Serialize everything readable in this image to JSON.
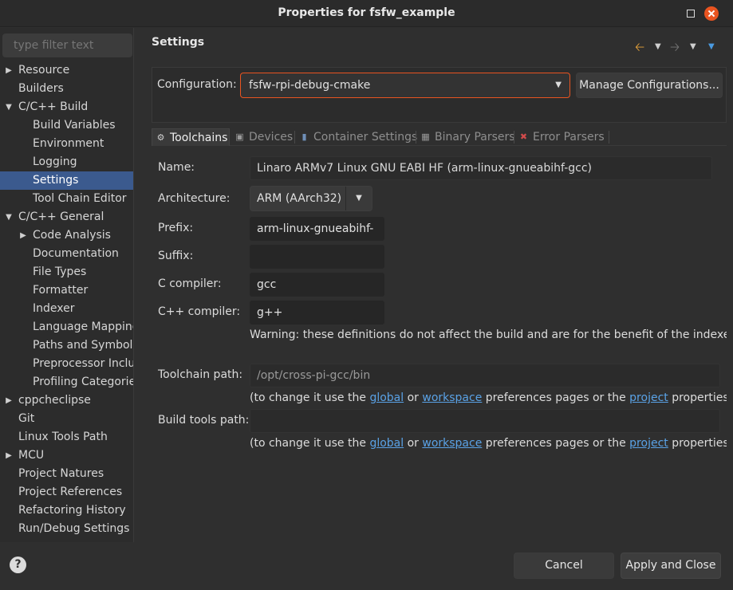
{
  "window": {
    "title": "Properties for fsfw_example"
  },
  "sidebar": {
    "filter_placeholder": "type filter text",
    "items": [
      {
        "label": "Resource",
        "arrow": "▶"
      },
      {
        "label": "Builders"
      },
      {
        "label": "C/C++ Build",
        "arrow": "▼"
      },
      {
        "label": "Build Variables"
      },
      {
        "label": "Environment"
      },
      {
        "label": "Logging"
      },
      {
        "label": "Settings"
      },
      {
        "label": "Tool Chain Editor"
      },
      {
        "label": "C/C++ General",
        "arrow": "▼"
      },
      {
        "label": "Code Analysis",
        "arrow": "▶"
      },
      {
        "label": "Documentation"
      },
      {
        "label": "File Types"
      },
      {
        "label": "Formatter"
      },
      {
        "label": "Indexer"
      },
      {
        "label": "Language Mapping"
      },
      {
        "label": "Paths and Symbols"
      },
      {
        "label": "Preprocessor Inclu"
      },
      {
        "label": "Profiling Categorie"
      },
      {
        "label": "cppcheclipse",
        "arrow": "▶"
      },
      {
        "label": "Git"
      },
      {
        "label": "Linux Tools Path"
      },
      {
        "label": "MCU",
        "arrow": "▶"
      },
      {
        "label": "Project Natures"
      },
      {
        "label": "Project References"
      },
      {
        "label": "Refactoring History"
      },
      {
        "label": "Run/Debug Settings"
      }
    ]
  },
  "header": {
    "title": "Settings"
  },
  "configuration": {
    "label": "Configuration:",
    "value": "fsfw-rpi-debug-cmake",
    "manage_label": "Manage Configurations..."
  },
  "tabs": [
    {
      "label": "Toolchains",
      "icon": "toolchain-icon"
    },
    {
      "label": "Devices",
      "icon": "devices-icon"
    },
    {
      "label": "Container Settings",
      "icon": "container-icon"
    },
    {
      "label": "Binary Parsers",
      "icon": "binary-icon"
    },
    {
      "label": "Error Parsers",
      "icon": "error-icon"
    }
  ],
  "toolchain": {
    "name_label": "Name:",
    "name_value": "Linaro ARMv7 Linux GNU EABI HF (arm-linux-gnueabihf-gcc)",
    "arch_label": "Architecture:",
    "arch_value": "ARM (AArch32)",
    "prefix_label": "Prefix:",
    "prefix_value": "arm-linux-gnueabihf-",
    "suffix_label": "Suffix:",
    "suffix_value": "",
    "c_label": "C compiler:",
    "c_value": "gcc",
    "cpp_label": "C++ compiler:",
    "cpp_value": "g++",
    "warning": "Warning: these definitions do not affect the build and are for the benefit of the indexer o",
    "path_label": "Toolchain path:",
    "path_value": "/opt/cross-pi-gcc/bin",
    "build_tools_label": "Build tools path:",
    "build_tools_value": "",
    "note_prefix": "(to change it use the ",
    "note_global": "global",
    "note_or": " or ",
    "note_workspace": "workspace",
    "note_mid": " preferences pages or the ",
    "note_project": "project",
    "note_suffix": " properties p"
  },
  "footer": {
    "help": "?",
    "cancel_label": "Cancel",
    "apply_label": "Apply and Close"
  },
  "colors": {
    "accent": "#e95420",
    "selection": "#3b5a8e",
    "link": "#5aa2e6"
  }
}
